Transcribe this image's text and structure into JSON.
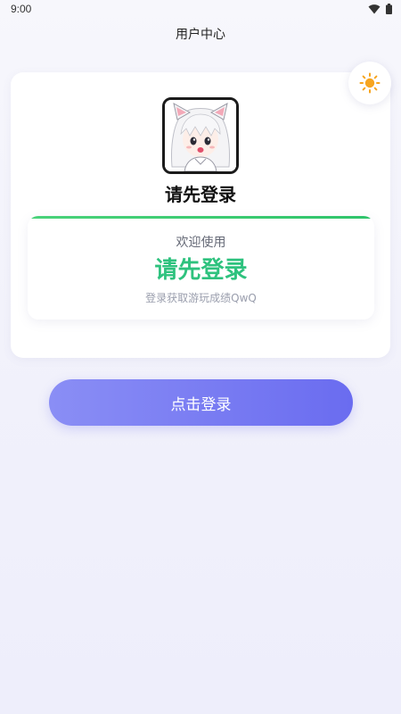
{
  "status_bar": {
    "time": "9:00",
    "icons": [
      "wifi-icon",
      "battery-icon"
    ]
  },
  "header": {
    "title": "用户中心"
  },
  "theme_toggle": {
    "icon": "sun-icon"
  },
  "profile": {
    "avatar": "anime-avatar",
    "name": "请先登录"
  },
  "welcome": {
    "label": "欢迎使用",
    "title": "请先登录",
    "subtitle": "登录获取游玩成绩QwQ"
  },
  "login_button": {
    "label": "点击登录"
  },
  "colors": {
    "accent_green": "#2ec27e",
    "button_gradient_start": "#8a8ef5",
    "button_gradient_end": "#6a6cf0",
    "sun": "#f7a51f"
  }
}
